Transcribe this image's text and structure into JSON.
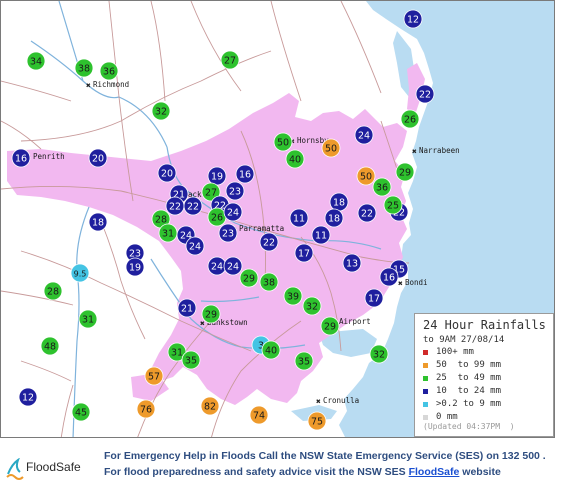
{
  "map": {
    "places": [
      {
        "id": "richmond",
        "label": "Richmond"
      },
      {
        "id": "penrith",
        "label": "Penrith"
      },
      {
        "id": "blacktown",
        "label": "Blacktown"
      },
      {
        "id": "hornsby",
        "label": "Hornsby"
      },
      {
        "id": "narrabeen",
        "label": "Narrabeen"
      },
      {
        "id": "parramatta",
        "label": "Parramatta"
      },
      {
        "id": "bondi",
        "label": "Bondi"
      },
      {
        "id": "bankstown",
        "label": "Bankstown"
      },
      {
        "id": "airport",
        "label": "Airport"
      },
      {
        "id": "cronulla",
        "label": "Cronulla"
      }
    ],
    "gauges": [
      {
        "value": "12",
        "band": "10-24"
      },
      {
        "value": "34",
        "band": "25-49"
      },
      {
        "value": "38",
        "band": "25-49"
      },
      {
        "value": "36",
        "band": "25-49"
      },
      {
        "value": "27",
        "band": "25-49"
      },
      {
        "value": "22",
        "band": "10-24"
      },
      {
        "value": "32",
        "band": "25-49"
      },
      {
        "value": "26",
        "band": "25-49"
      },
      {
        "value": "24",
        "band": "10-24"
      },
      {
        "value": "50",
        "band": "50-99"
      },
      {
        "value": "50",
        "band": "25-49"
      },
      {
        "value": "40",
        "band": "25-49"
      },
      {
        "value": "16",
        "band": "10-24"
      },
      {
        "value": "20",
        "band": "10-24"
      },
      {
        "value": "20",
        "band": "10-24"
      },
      {
        "value": "19",
        "band": "10-24"
      },
      {
        "value": "16",
        "band": "10-24"
      },
      {
        "value": "50",
        "band": "50-99"
      },
      {
        "value": "36",
        "band": "25-49"
      },
      {
        "value": "29",
        "band": "25-49"
      },
      {
        "value": "21",
        "band": "10-24"
      },
      {
        "value": "27",
        "band": "25-49"
      },
      {
        "value": "23",
        "band": "10-24"
      },
      {
        "value": "22",
        "band": "10-24"
      },
      {
        "value": "22",
        "band": "10-24"
      },
      {
        "value": "22",
        "band": "10-24"
      },
      {
        "value": "26",
        "band": "25-49"
      },
      {
        "value": "24",
        "band": "10-24"
      },
      {
        "value": "18",
        "band": "10-24"
      },
      {
        "value": "22",
        "band": "10-24"
      },
      {
        "value": "25",
        "band": "25-49"
      },
      {
        "value": "22",
        "band": "10-24"
      },
      {
        "value": "18",
        "band": "10-24"
      },
      {
        "value": "28",
        "band": "25-49"
      },
      {
        "value": "31",
        "band": "25-49"
      },
      {
        "value": "24",
        "band": "10-24"
      },
      {
        "value": "24",
        "band": "10-24"
      },
      {
        "value": "23",
        "band": "10-24"
      },
      {
        "value": "11",
        "band": "10-24"
      },
      {
        "value": "18",
        "band": "10-24"
      },
      {
        "value": "11",
        "band": "10-24"
      },
      {
        "value": "22",
        "band": "10-24"
      },
      {
        "value": "23",
        "band": "10-24"
      },
      {
        "value": "19",
        "band": "10-24"
      },
      {
        "value": "9.5",
        "band": "0.2-9"
      },
      {
        "value": "24",
        "band": "10-24"
      },
      {
        "value": "24",
        "band": "10-24"
      },
      {
        "value": "29",
        "band": "25-49"
      },
      {
        "value": "38",
        "band": "25-49"
      },
      {
        "value": "17",
        "band": "10-24"
      },
      {
        "value": "13",
        "band": "10-24"
      },
      {
        "value": "15",
        "band": "10-24"
      },
      {
        "value": "16",
        "band": "10-24"
      },
      {
        "value": "28",
        "band": "25-49"
      },
      {
        "value": "39",
        "band": "25-49"
      },
      {
        "value": "32",
        "band": "25-49"
      },
      {
        "value": "17",
        "band": "10-24"
      },
      {
        "value": "21",
        "band": "10-24"
      },
      {
        "value": "29",
        "band": "25-49"
      },
      {
        "value": "31",
        "band": "25-49"
      },
      {
        "value": "29",
        "band": "25-49"
      },
      {
        "value": "48",
        "band": "25-49"
      },
      {
        "value": "3",
        "band": "0.2-9"
      },
      {
        "value": "40",
        "band": "25-49"
      },
      {
        "value": "31",
        "band": "25-49"
      },
      {
        "value": "35",
        "band": "25-49"
      },
      {
        "value": "35",
        "band": "25-49"
      },
      {
        "value": "32",
        "band": "25-49"
      },
      {
        "value": "57",
        "band": "50-99"
      },
      {
        "value": "12",
        "band": "10-24"
      },
      {
        "value": "76",
        "band": "50-99"
      },
      {
        "value": "82",
        "band": "50-99"
      },
      {
        "value": "74",
        "band": "50-99"
      },
      {
        "value": "45",
        "band": "25-49"
      },
      {
        "value": "75",
        "band": "50-99"
      }
    ]
  },
  "legend": {
    "title": "24 Hour Rainfalls",
    "subtitle": "to 9AM 27/08/14",
    "items": [
      {
        "label": "100+ mm",
        "color": "#d02a2a"
      },
      {
        "label": "50  to 99 mm",
        "color": "#ee9a2b"
      },
      {
        "label": "25  to 49 mm",
        "color": "#2ec22e"
      },
      {
        "label": "10  to 24 mm",
        "color": "#1f1f9e"
      },
      {
        "label": ">0.2 to 9 mm",
        "color": "#44c4e4"
      },
      {
        "label": "0 mm",
        "color": "#d7d7d7"
      }
    ],
    "updated": "(Updated 04:37PM  )"
  },
  "colors": {
    "100+": "#d02a2a",
    "50-99": "#ee9a2b",
    "25-49": "#2ec22e",
    "10-24": "#1f1f9e",
    "0.2-9": "#44c4e4",
    "0": "#d7d7d7",
    "urban": "#f2b8f0",
    "ocean": "#b9dcf2"
  },
  "footer": {
    "logo_text": "FloodSafe",
    "line1": "For Emergency Help in Floods Call the NSW State Emergency Service (SES) on 132 500 .",
    "line2_before": "For flood preparedness and safety advice visit the NSW SES ",
    "line2_link": "FloodSafe",
    "line2_after": " website"
  }
}
